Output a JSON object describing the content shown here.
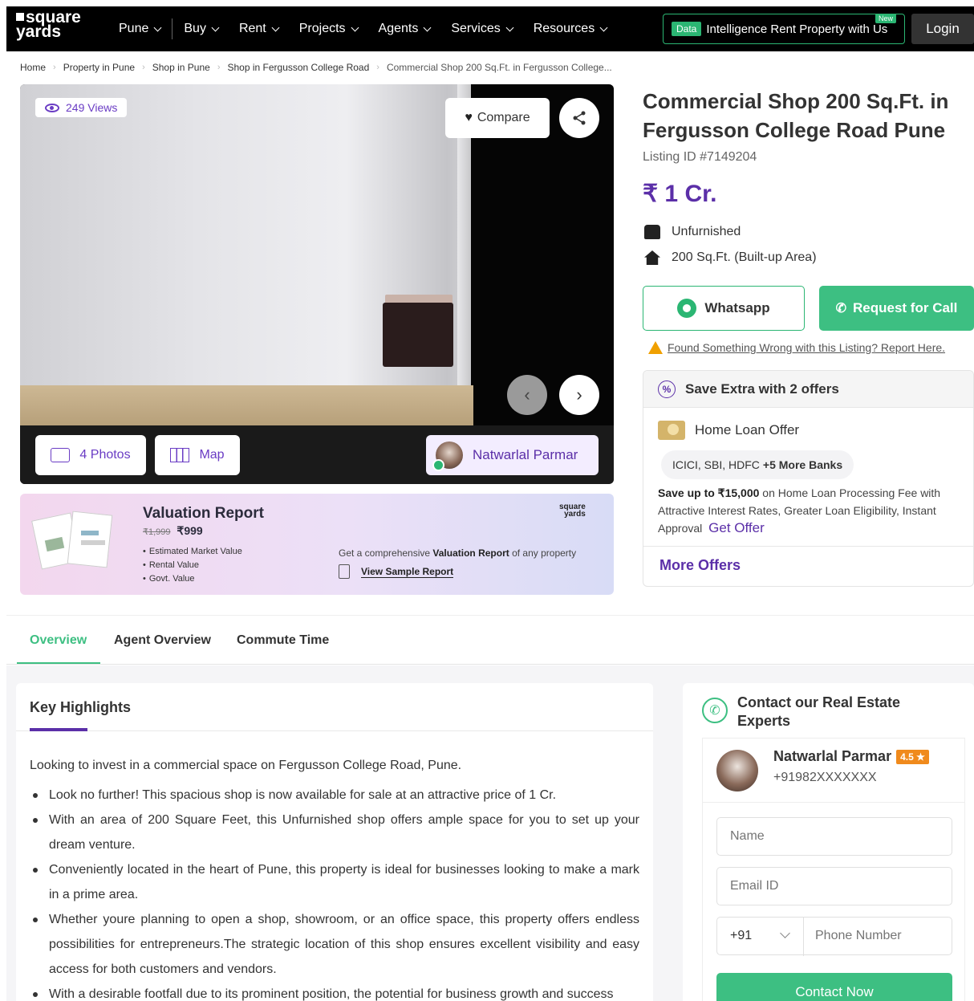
{
  "nav": {
    "logo_top": "square",
    "logo_bottom": "yards",
    "items": [
      {
        "label": "Pune"
      },
      {
        "label": "Buy"
      },
      {
        "label": "Rent"
      },
      {
        "label": "Projects"
      },
      {
        "label": "Agents"
      },
      {
        "label": "Services"
      },
      {
        "label": "Resources"
      }
    ],
    "promo_badge": "Data",
    "promo_text": "Intelligence Rent Property with Us",
    "new_badge": "New",
    "login": "Login"
  },
  "breadcrumb": [
    "Home",
    "Property in Pune",
    "Shop in Pune",
    "Shop in Fergusson College Road",
    "Commercial Shop 200 Sq.Ft. in Fergusson College..."
  ],
  "gallery": {
    "views": "249 Views",
    "compare": "Compare",
    "photos": "4 Photos",
    "map": "Map",
    "agent_name": "Natwarlal Parmar"
  },
  "valuation": {
    "title": "Valuation Report",
    "old_price": "₹1,999",
    "price": "₹999",
    "items": [
      "Estimated Market Value",
      "Rental Value",
      "Govt. Value"
    ],
    "logo_top": "square",
    "logo_bottom": "yards",
    "desc_pre": "Get a comprehensive ",
    "desc_bold": "Valuation Report",
    "desc_post": " of any property",
    "link": "View Sample Report"
  },
  "listing": {
    "title": "Commercial Shop 200 Sq.Ft. in Fergusson College Road Pune",
    "listing_id": "Listing ID #7149204",
    "price": "₹ 1 Cr.",
    "furnishing": "Unfurnished",
    "area": "200 Sq.Ft. (Built-up Area)",
    "whatsapp": "Whatsapp",
    "request_call": "Request for Call",
    "report": "Found Something Wrong with this Listing? Report Here."
  },
  "offers": {
    "header": "Save Extra with 2 offers",
    "loan_title": "Home Loan Offer",
    "banks": "ICICI, SBI, HDFC",
    "banks_more": "+5 More Banks",
    "desc_bold": "Save up to ₹15,000",
    "desc": " on Home Loan Processing Fee with Attractive Interest Rates, Greater Loan Eligibility, Instant Approval",
    "get_offer": "Get Offer",
    "more": "More Offers"
  },
  "tabs": [
    {
      "label": "Overview"
    },
    {
      "label": "Agent Overview"
    },
    {
      "label": "Commute Time"
    }
  ],
  "highlights": {
    "title": "Key Highlights",
    "intro": "Looking to invest in a commercial space on Fergusson College Road, Pune.",
    "points": [
      "Look no further! This spacious shop is now available for sale at an attractive price of 1 Cr.",
      "With an area of 200 Square Feet, this Unfurnished shop offers ample space for you to set up your dream venture.",
      "Conveniently located in the heart of Pune, this property is ideal for businesses looking to make a mark in a prime area.",
      "Whether youre planning to open a shop, showroom, or an office space, this property offers endless possibilities for entrepreneurs.The strategic location of this shop ensures excellent visibility and easy access for both customers and vendors.",
      "With a desirable footfall due to its prominent position, the potential for business growth and success"
    ]
  },
  "contact": {
    "title": "Contact our Real Estate Experts",
    "agent_name": "Natwarlal Parmar",
    "rating": "4.5 ★",
    "phone": "+91982XXXXXXX",
    "name_placeholder": "Name",
    "email_placeholder": "Email ID",
    "country_code": "+91",
    "phone_placeholder": "Phone Number",
    "button": "Contact Now"
  },
  "colors": {
    "brand_purple": "#5b2fa8",
    "accent_green": "#3dbf82",
    "nav_bg": "#000000"
  }
}
